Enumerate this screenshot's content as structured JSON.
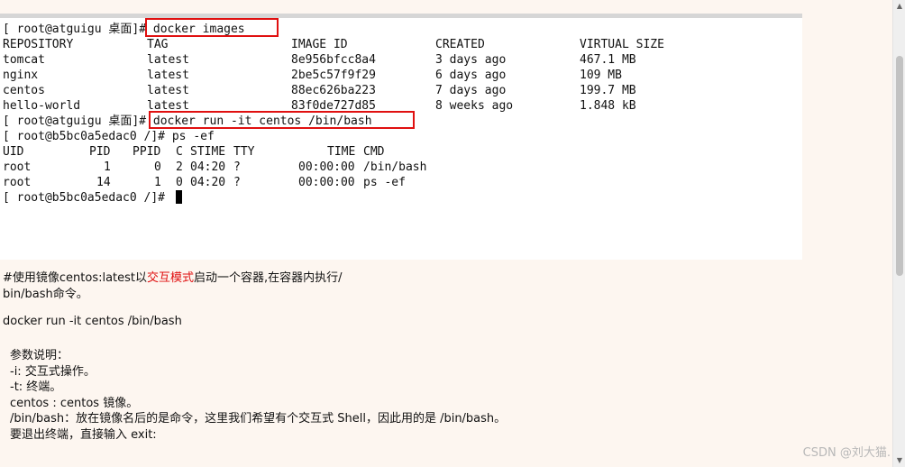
{
  "terminal": {
    "prompt_atguigu": "[ root@atguigu 桌面]# ",
    "prompt_container": "[ root@b5bc0a5edac0 /]# ",
    "cmd_images": "docker images",
    "images_table": {
      "headers": [
        "REPOSITORY",
        "TAG",
        "IMAGE ID",
        "CREATED",
        "VIRTUAL SIZE"
      ],
      "rows": [
        [
          "tomcat",
          "latest",
          "8e956bfcc8a4",
          "3 days ago",
          "467.1 MB"
        ],
        [
          "nginx",
          "latest",
          "2be5c57f9f29",
          "6 days ago",
          "109 MB"
        ],
        [
          "centos",
          "latest",
          "88ec626ba223",
          "7 days ago",
          "199.7 MB"
        ],
        [
          "hello-world",
          "latest",
          "83f0de727d85",
          "8 weeks ago",
          "1.848 kB"
        ]
      ]
    },
    "cmd_run": "docker run -it centos /bin/bash",
    "cmd_ps": "ps -ef",
    "ps_table": {
      "headers": [
        "UID",
        "PID",
        "PPID",
        "C",
        "STIME",
        "TTY",
        "TIME",
        "CMD"
      ],
      "rows": [
        [
          "root",
          "1",
          "0",
          "2",
          "04:20",
          "?",
          "00:00:00",
          "/bin/bash"
        ],
        [
          "root",
          "14",
          "1",
          "0",
          "04:20",
          "?",
          "00:00:00",
          "ps -ef"
        ]
      ]
    }
  },
  "article": {
    "desc_part1": "#使用镜像centos:latest以",
    "desc_highlight": "交互模式",
    "desc_part2": "启动一个容器,在容器内执行/",
    "desc_line2": "bin/bash命令。",
    "command": "docker run -it centos /bin/bash",
    "params_title": "参数说明：",
    "params": [
      "-i: 交互式操作。",
      "-t: 终端。",
      "centos : centos 镜像。",
      "/bin/bash：放在镜像名后的是命令，这里我们希望有个交互式 Shell，因此用的是 /bin/bash。",
      "要退出终端，直接输入 exit:"
    ]
  },
  "watermark": "CSDN @刘大猫.",
  "colors": {
    "highlight_box": "#e01010",
    "background": "#fdf6f0"
  }
}
